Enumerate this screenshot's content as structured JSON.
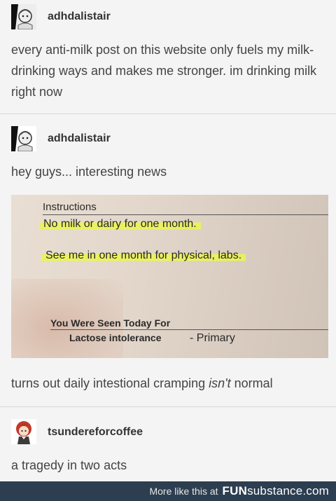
{
  "posts": [
    {
      "username": "adhdalistair",
      "text": "every anti-milk post on this website only fuels my milk-drinking ways and makes me stronger. im drinking milk right now"
    },
    {
      "username": "adhdalistair",
      "text": "hey guys... interesting news",
      "photo": {
        "heading": "Instructions",
        "line1": "No milk or dairy for one month.",
        "line2": "See me in one month for physical, labs.",
        "seen_label": "You Were Seen Today For",
        "diagnosis": "Lactose intolerance",
        "diagnosis_type": "- Primary"
      },
      "caption_before": "turns out daily intestional cramping ",
      "caption_em": "isn't",
      "caption_after": " normal"
    },
    {
      "username": "tsundereforcoffee",
      "text": "a tragedy in two acts"
    }
  ],
  "footer": {
    "more_text": "More like this at",
    "brand_fun": "FUN",
    "brand_rest": "substance",
    "brand_tld": ".com",
    "bg_color": "#2c3e50"
  }
}
